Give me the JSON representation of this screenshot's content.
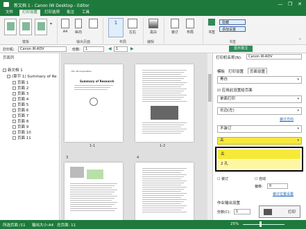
{
  "window": {
    "title": "新文档 1 - Canon iW Desktop - Editor",
    "min": "—",
    "max": "❐",
    "close": "✕"
  },
  "menu": [
    "文件",
    "打印设置",
    "打印选项",
    "批注",
    "工具"
  ],
  "ribbon": {
    "groups": [
      "模板",
      "输出页面",
      "布局",
      "编辑",
      "书签"
    ],
    "buttons": [
      "A4",
      "纵向",
      "1",
      "左右",
      "黑白",
      "装订",
      "布局",
      "书签"
    ],
    "small": [
      "隐藏",
      "添加设置"
    ],
    "collapse": "设置批注"
  },
  "toolbar": {
    "printer_label": "打印机:",
    "printer_value": "Canon iR-ADV",
    "copies_label": "份数:",
    "copies_value": "1",
    "pages": "1",
    "right_label": "显示批注"
  },
  "tree": {
    "header": "页面列",
    "root": "新文档 1",
    "doc": "(章节 1) Summary of Re",
    "pages": [
      "页面 1",
      "页面 2",
      "页面 3",
      "页面 4",
      "页面 5",
      "页面 6",
      "页面 7",
      "页面 8",
      "页面 9",
      "页面 10",
      "页面 11"
    ]
  },
  "pages": {
    "labels": [
      "1-1",
      "1-2",
      "3",
      "4"
    ],
    "p1_title": "Summary of Research",
    "p1_org": "Pro. 20 Corporation"
  },
  "settings": {
    "printer_label": "打印机名称(N):",
    "printer_value": "Canon iR-ADV",
    "tabs": [
      "模板",
      "打印设置",
      "页面设置"
    ],
    "color": "黑白",
    "use_check": "应用此设置给页面",
    "sided": "单面打印",
    "duplex": "长边(左)",
    "link1": "装订方向",
    "staple": "不装订",
    "dropdown_value": "关",
    "options": [
      "关",
      "2 孔"
    ],
    "check2": "装订",
    "check3": "自动",
    "offset_label": "偏移:",
    "offset_value": "0",
    "link2": "装订位置设置",
    "output_label": "作业输出设置",
    "copies_label": "份数(C):",
    "copies_value": "1",
    "print_btn": "打印"
  },
  "status": {
    "pages": "所选页面 /11",
    "paper": "输出大小:A4",
    "total": "总页面: 11",
    "zoom": "25%"
  }
}
